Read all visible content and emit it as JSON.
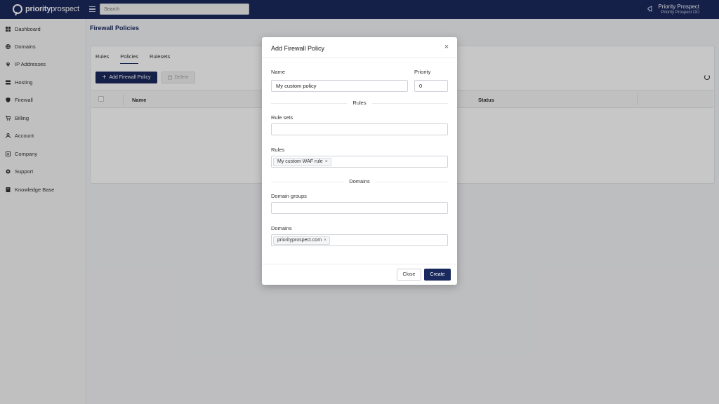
{
  "brand": {
    "bold": "priority",
    "light": "prospect"
  },
  "header": {
    "search_placeholder": "Search",
    "user_name": "Priority Prospect",
    "user_org": "Priority Prospect OÜ"
  },
  "sidebar": {
    "items": [
      {
        "label": "Dashboard",
        "icon": "dashboard-icon"
      },
      {
        "label": "Domains",
        "icon": "globe-icon"
      },
      {
        "label": "IP Addresses",
        "icon": "location-pin-icon"
      },
      {
        "label": "Hosting",
        "icon": "server-icon"
      },
      {
        "label": "Firewall",
        "icon": "shield-icon"
      },
      {
        "label": "Billing",
        "icon": "cart-icon"
      },
      {
        "label": "Account",
        "icon": "user-icon"
      },
      {
        "label": "Company",
        "icon": "building-icon"
      },
      {
        "label": "Support",
        "icon": "lifebuoy-icon"
      },
      {
        "label": "Knowledge Base",
        "icon": "book-icon"
      }
    ]
  },
  "page": {
    "title": "Firewall Policies",
    "tabs": [
      "Rules",
      "Policies",
      "Rulesets"
    ],
    "active_tab": "Policies",
    "add_button": "Add Firewall Policy",
    "delete_button": "Delete",
    "columns": {
      "name": "Name",
      "status": "Status"
    }
  },
  "modal": {
    "title": "Add Firewall Policy",
    "name_label": "Name",
    "name_value": "My custom policy",
    "priority_label": "Priority",
    "priority_value": "0",
    "rules_section": "Rules",
    "rule_sets_label": "Rule sets",
    "rules_label": "Rules",
    "rules_chip": "My custom WAF rule",
    "domains_section": "Domains",
    "domain_groups_label": "Domain groups",
    "domains_label": "Domains",
    "domains_chip": "priorityprospect.com",
    "close_button": "Close",
    "create_button": "Create"
  },
  "colors": {
    "brand_navy": "#1b2a5e"
  }
}
